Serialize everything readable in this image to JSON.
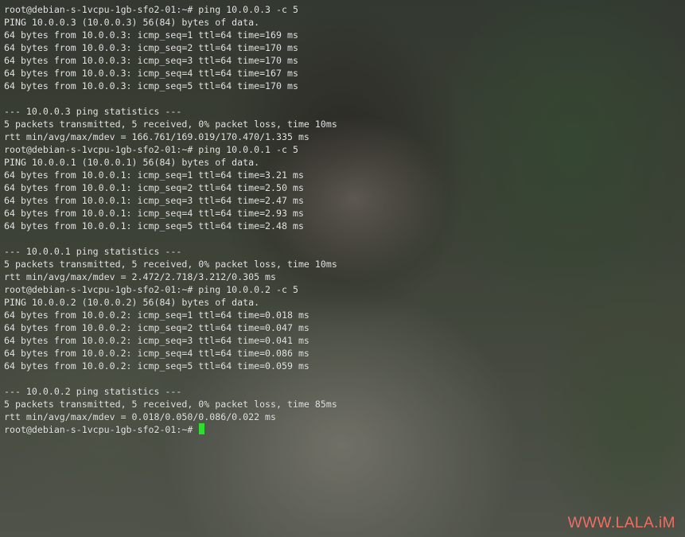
{
  "terminal": {
    "lines": [
      "root@debian-s-1vcpu-1gb-sfo2-01:~# ping 10.0.0.3 -c 5",
      "PING 10.0.0.3 (10.0.0.3) 56(84) bytes of data.",
      "64 bytes from 10.0.0.3: icmp_seq=1 ttl=64 time=169 ms",
      "64 bytes from 10.0.0.3: icmp_seq=2 ttl=64 time=170 ms",
      "64 bytes from 10.0.0.3: icmp_seq=3 ttl=64 time=170 ms",
      "64 bytes from 10.0.0.3: icmp_seq=4 ttl=64 time=167 ms",
      "64 bytes from 10.0.0.3: icmp_seq=5 ttl=64 time=170 ms",
      "",
      "--- 10.0.0.3 ping statistics ---",
      "5 packets transmitted, 5 received, 0% packet loss, time 10ms",
      "rtt min/avg/max/mdev = 166.761/169.019/170.470/1.335 ms",
      "root@debian-s-1vcpu-1gb-sfo2-01:~# ping 10.0.0.1 -c 5",
      "PING 10.0.0.1 (10.0.0.1) 56(84) bytes of data.",
      "64 bytes from 10.0.0.1: icmp_seq=1 ttl=64 time=3.21 ms",
      "64 bytes from 10.0.0.1: icmp_seq=2 ttl=64 time=2.50 ms",
      "64 bytes from 10.0.0.1: icmp_seq=3 ttl=64 time=2.47 ms",
      "64 bytes from 10.0.0.1: icmp_seq=4 ttl=64 time=2.93 ms",
      "64 bytes from 10.0.0.1: icmp_seq=5 ttl=64 time=2.48 ms",
      "",
      "--- 10.0.0.1 ping statistics ---",
      "5 packets transmitted, 5 received, 0% packet loss, time 10ms",
      "rtt min/avg/max/mdev = 2.472/2.718/3.212/0.305 ms",
      "root@debian-s-1vcpu-1gb-sfo2-01:~# ping 10.0.0.2 -c 5",
      "PING 10.0.0.2 (10.0.0.2) 56(84) bytes of data.",
      "64 bytes from 10.0.0.2: icmp_seq=1 ttl=64 time=0.018 ms",
      "64 bytes from 10.0.0.2: icmp_seq=2 ttl=64 time=0.047 ms",
      "64 bytes from 10.0.0.2: icmp_seq=3 ttl=64 time=0.041 ms",
      "64 bytes from 10.0.0.2: icmp_seq=4 ttl=64 time=0.086 ms",
      "64 bytes from 10.0.0.2: icmp_seq=5 ttl=64 time=0.059 ms",
      "",
      "--- 10.0.0.2 ping statistics ---",
      "5 packets transmitted, 5 received, 0% packet loss, time 85ms",
      "rtt min/avg/max/mdev = 0.018/0.050/0.086/0.022 ms"
    ],
    "prompt": "root@debian-s-1vcpu-1gb-sfo2-01:~# ",
    "cursor_color": "#2fdc2f"
  },
  "watermark": {
    "text": "WWW.LALA.iM",
    "color": "#ef6f64"
  }
}
